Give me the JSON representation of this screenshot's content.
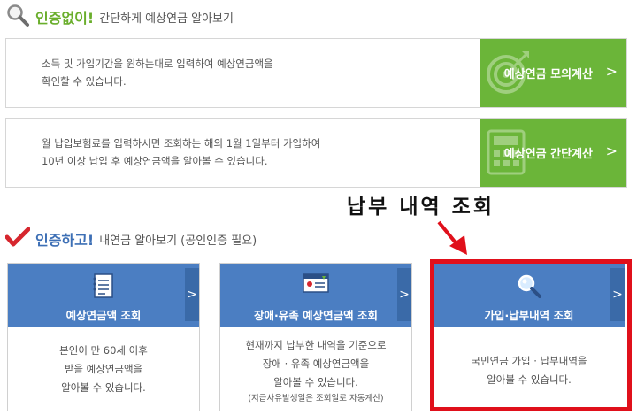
{
  "section1": {
    "highlight": "인증없이!",
    "rest": "간단하게 예상연금 알아보기",
    "icon": "magnifier-icon",
    "accent": "#6aae2c"
  },
  "calc_cards": [
    {
      "line1": "소득 및 가입기간을 원하는대로 입력하여 예상연금액을",
      "line2": "확인할 수 있습니다.",
      "button_label": "예상연금 모의계산",
      "chevron": ">",
      "icon": "target-icon"
    },
    {
      "line1": "월 납입보험료를 입력하시면 조회하는 해의 1월 1일부터 가입하여",
      "line2": "10년 이상 납입 후 예상연금액을 알아볼 수 있습니다.",
      "button_label": "예상연금 간단계산",
      "chevron": ">",
      "icon": "calculator-icon"
    }
  ],
  "callout": "납부 내역 조회",
  "section2": {
    "highlight": "인증하고!",
    "rest": "내연금 알아보기 (공인인증 필요)",
    "icon": "checkmark-icon",
    "accent": "#3d6fb5"
  },
  "services": [
    {
      "title": "예상연금액 조회",
      "chevron": ">",
      "icon": "notepad-icon",
      "lines": [
        "본인이 만 60세 이후",
        "받을 예상연금액을",
        "알아볼 수 있습니다."
      ],
      "note": ""
    },
    {
      "title": "장애·유족 예상연금액 조회",
      "chevron": ">",
      "icon": "id-card-icon",
      "lines": [
        "현재까지 납부한 내역을 기준으로",
        "장애 · 유족 예상연금액을",
        "알아볼 수 있습니다."
      ],
      "note": "(지급사유발생일은 조회일로 자동계산)"
    },
    {
      "title": "가입·납부내역 조회",
      "chevron": ">",
      "icon": "search-icon",
      "lines": [
        "국민연금 가입 · 납부내역을",
        "알아볼 수 있습니다."
      ],
      "note": ""
    }
  ],
  "colors": {
    "green_button": "#6bb539",
    "blue_card": "#4b7ec2",
    "highlight_box": "#e0101b"
  }
}
